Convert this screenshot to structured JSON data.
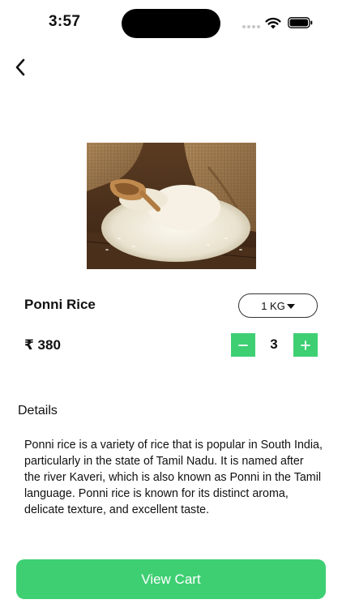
{
  "status_bar": {
    "time": "3:57"
  },
  "icons": {
    "back": "chevron-left-icon",
    "wifi": "wifi-icon",
    "battery": "battery-icon",
    "decrement": "minus-icon",
    "increment": "plus-icon",
    "dropdown": "caret-down-icon"
  },
  "product": {
    "name": "Ponni Rice",
    "weight_option": "1 KG",
    "price": "₹ 380",
    "quantity": "3",
    "image": "rice-in-burlap-sack-photo"
  },
  "details": {
    "heading": "Details",
    "text": "Ponni rice is a variety of rice that is popular in South India, particularly in the state of Tamil Nadu. It is named after the river Kaveri, which is also known as Ponni in the Tamil language. Ponni rice is known for its distinct aroma, delicate texture, and excellent taste."
  },
  "actions": {
    "view_cart_label": "View Cart"
  },
  "colors": {
    "accent": "#3ecf73",
    "text": "#111111",
    "background": "#ffffff"
  }
}
